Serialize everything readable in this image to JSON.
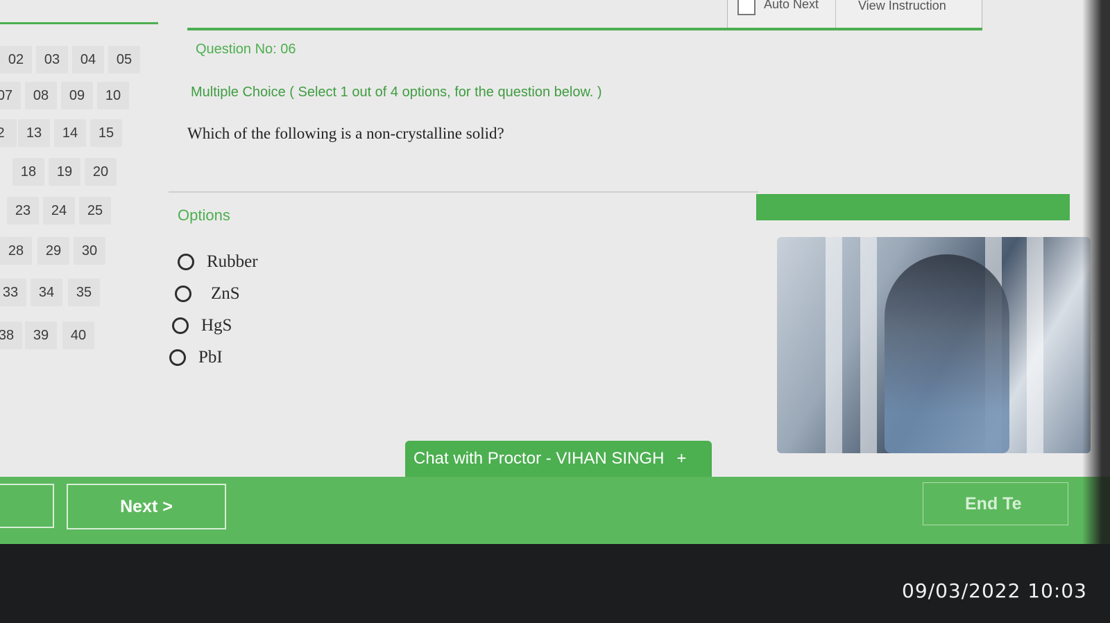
{
  "header": {
    "auto_next_label": "Auto Next",
    "view_instruction_label": "View Instruction"
  },
  "palette": {
    "rows": [
      [
        "02",
        "03",
        "04",
        "05"
      ],
      [
        "07",
        "08",
        "09",
        "10"
      ],
      [
        "2",
        "13",
        "14",
        "15"
      ],
      [
        "18",
        "19",
        "20"
      ],
      [
        "23",
        "24",
        "25"
      ],
      [
        "28",
        "29",
        "30"
      ],
      [
        "33",
        "34",
        "35"
      ],
      [
        "38",
        "39",
        "40"
      ]
    ]
  },
  "question": {
    "number_label": "Question No: 06",
    "type_label": "Multiple Choice ( Select 1 out of 4 options, for the question below. )",
    "text": "Which of the following is a non-crystalline solid?"
  },
  "options": {
    "label": "Options",
    "items": [
      "Rubber",
      "ZnS",
      "HgS",
      "PbI"
    ]
  },
  "chat": {
    "label": "Chat with Proctor - VIHAN SINGH",
    "plus": "+"
  },
  "footer": {
    "next_label": "Next >",
    "end_label": "End Te"
  },
  "photo_timestamp": "09/03/2022 10:03",
  "colors": {
    "accent": "#4caf50",
    "bottom_bar": "#5cb85c"
  }
}
